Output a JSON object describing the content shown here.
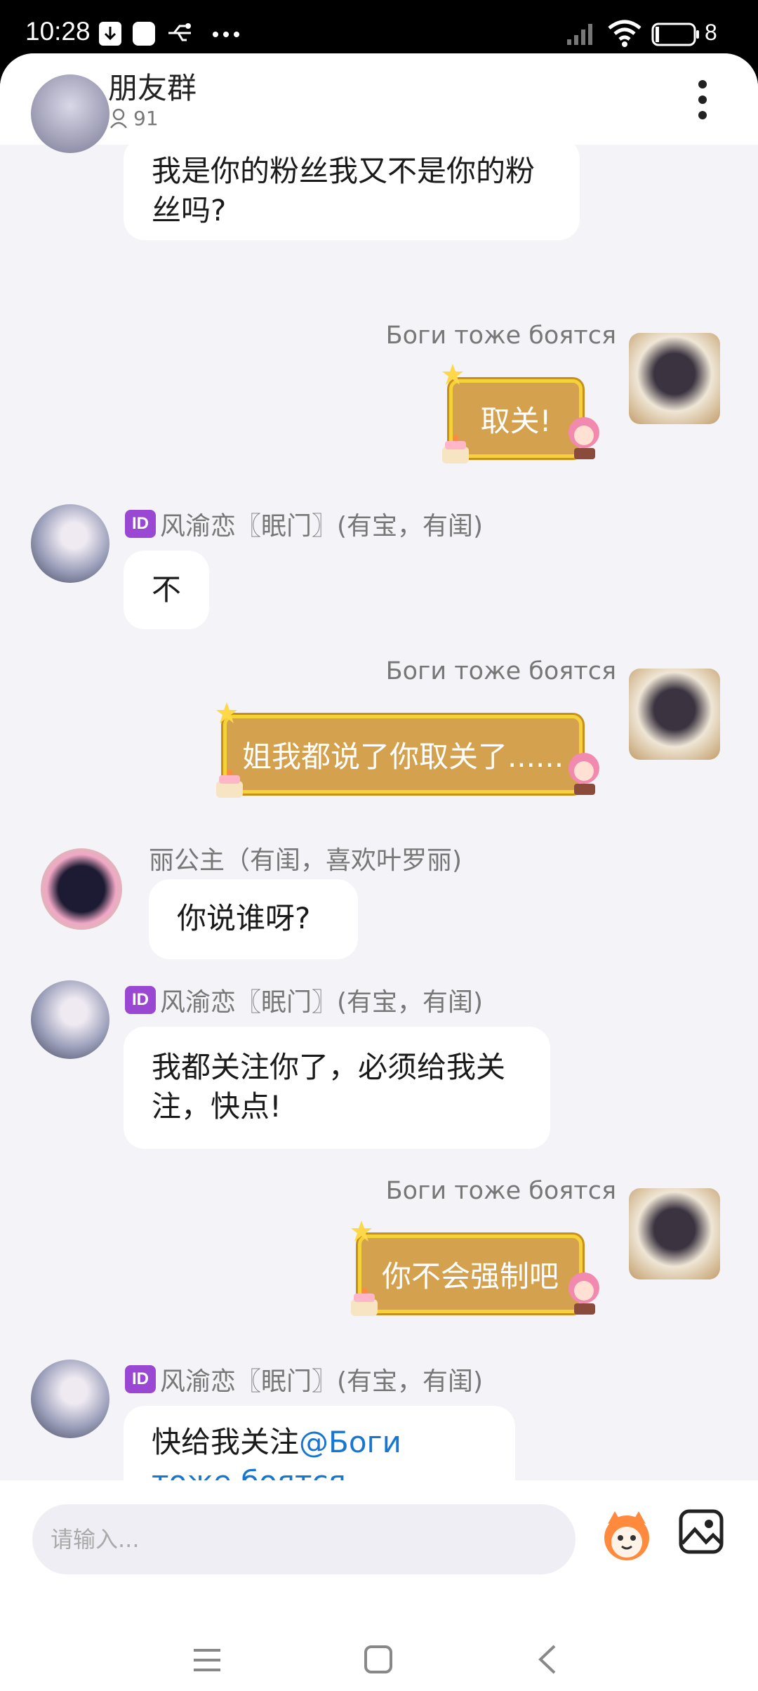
{
  "status_bar": {
    "time": "10:28",
    "battery": "8"
  },
  "header": {
    "title": "朋友群",
    "member_count": "91"
  },
  "messages": [
    {
      "sender": "",
      "text": "我是你的粉丝我又不是你的粉丝吗?"
    },
    {
      "sender": "Боги тоже боятся",
      "text": "取关!"
    },
    {
      "sender": "风渝恋〖眠门〗(有宝，有闺)",
      "text": "不",
      "badge": "ID"
    },
    {
      "sender": "Боги тоже боятся",
      "text": "姐我都说了你取关了......"
    },
    {
      "sender": "丽公主（有闺，喜欢叶罗丽)",
      "text": "你说谁呀?"
    },
    {
      "sender": "风渝恋〖眠门〗(有宝，有闺)",
      "text": "我都关注你了，必须给我关注，快点!",
      "badge": "ID"
    },
    {
      "sender": "Боги тоже боятся",
      "text": "你不会强制吧"
    },
    {
      "sender": "风渝恋〖眠门〗(有宝，有闺)",
      "text_prefix": "快给我关注",
      "mention": "@Боги тоже боятся",
      "badge": "ID"
    }
  ],
  "input": {
    "placeholder": "请输入..."
  },
  "colors": {
    "gold_bubble": "#d4a24e",
    "gold_border": "#f5d13a",
    "mention": "#1677d2",
    "id_badge": "#9a48d4"
  }
}
